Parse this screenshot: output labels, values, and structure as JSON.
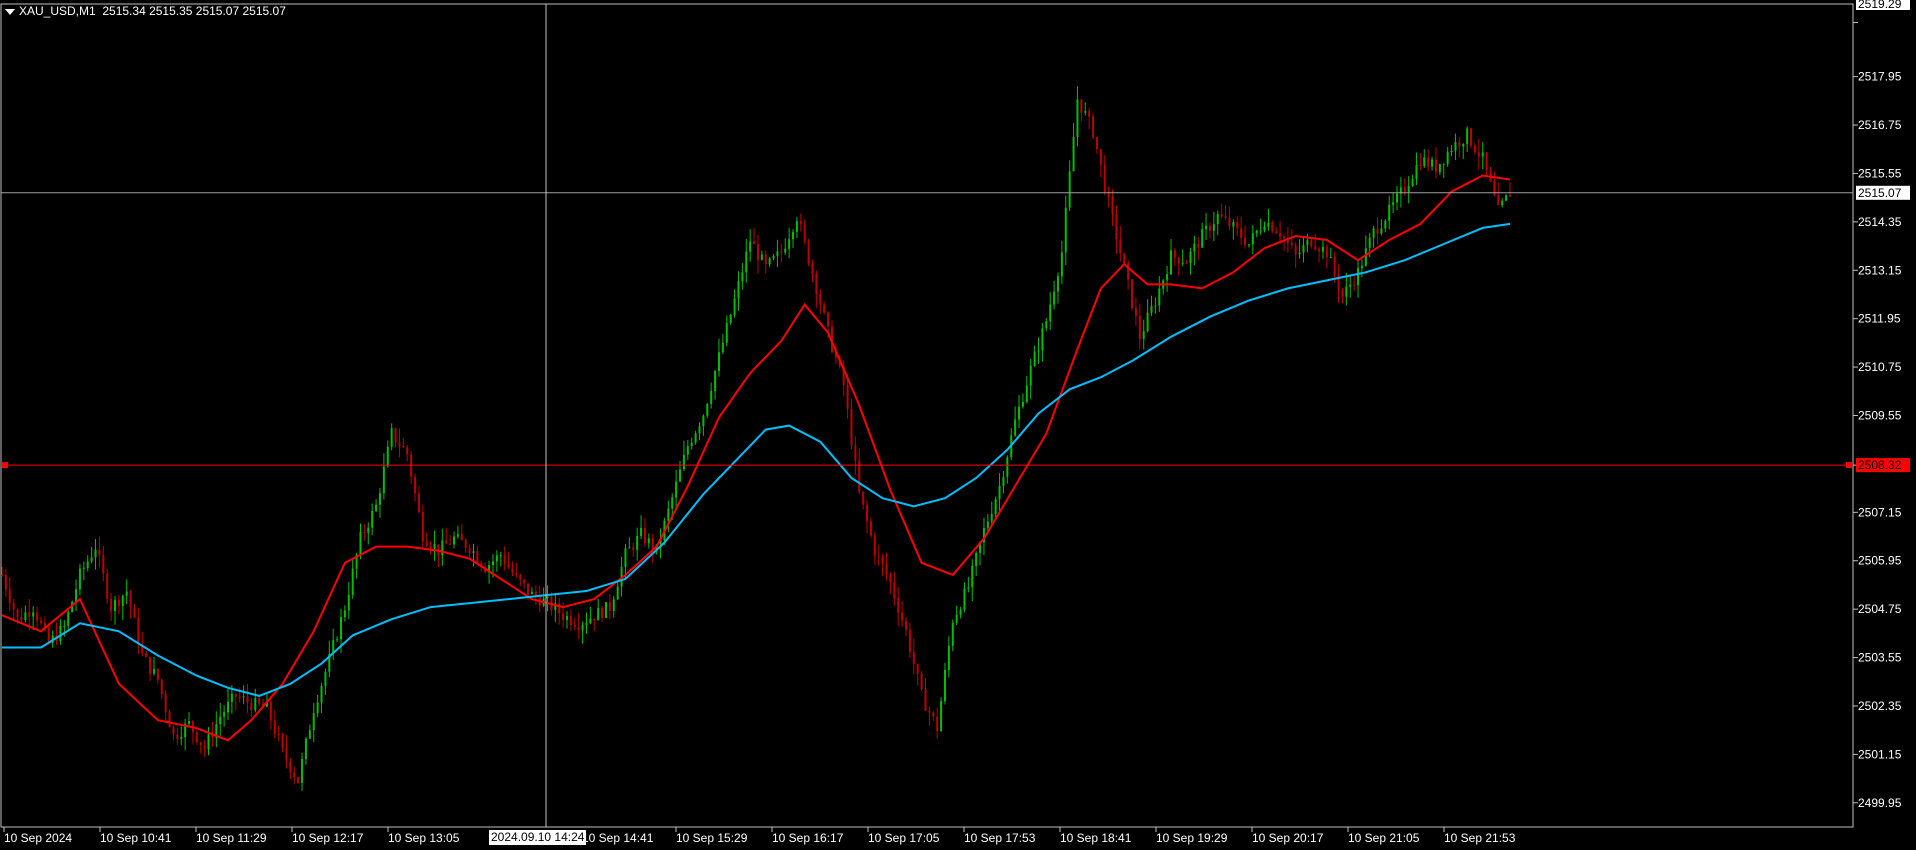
{
  "window": {
    "symbol_title": "XAU_USD,M1",
    "ohlc": "2515.34 2515.35 2515.07 2515.07",
    "crosshair_time": "2024.09.10 14:24"
  },
  "colors": {
    "background": "#000000",
    "grid_frame": "#c0c0c0",
    "bull": "#00c000",
    "bear": "#c00000",
    "ma_fast": "#ff0000",
    "ma_slow": "#00bfff",
    "hline": "#ff0000",
    "bid_line": "#a0a0a0"
  },
  "chart_data": {
    "type": "line",
    "title": "XAU_USD,M1",
    "ylim": [
      2499.35,
      2519.75
    ],
    "y_ticks": [
      "2519.29",
      "2517.95",
      "2516.75",
      "2515.55",
      "2514.35",
      "2513.15",
      "2511.95",
      "2510.75",
      "2509.55",
      "2508.32",
      "2507.15",
      "2505.95",
      "2504.75",
      "2503.55",
      "2502.35",
      "2501.15",
      "2499.95"
    ],
    "x_ticks": [
      "10 Sep 2024",
      "10 Sep 10:41",
      "10 Sep 11:29",
      "10 Sep 12:17",
      "10 Sep 13:05",
      "10 Sep 14:24",
      "10 Sep 15:29",
      "10 Sep 16:17",
      "10 Sep 17:05",
      "10 Sep 17:53",
      "10 Sep 18:41",
      "10 Sep 19:29",
      "10 Sep 20:17",
      "10 Sep 21:05",
      "10 Sep 21:53"
    ],
    "x_tick_partial_label": "10 Sep 14:41",
    "current_price": "2515.07",
    "horizontal_level": "2508.32",
    "top_label": "2519.29",
    "price_path": [
      [
        0,
        2505.6
      ],
      [
        4,
        2504.5
      ],
      [
        8,
        2504.8
      ],
      [
        12,
        2503.9
      ],
      [
        16,
        2504.3
      ],
      [
        20,
        2505.6
      ],
      [
        24,
        2506.3
      ],
      [
        28,
        2504.8
      ],
      [
        32,
        2505.2
      ],
      [
        36,
        2503.6
      ],
      [
        40,
        2503.0
      ],
      [
        44,
        2501.6
      ],
      [
        48,
        2501.9
      ],
      [
        52,
        2501.3
      ],
      [
        56,
        2502.1
      ],
      [
        60,
        2502.6
      ],
      [
        64,
        2502.4
      ],
      [
        68,
        2502.3
      ],
      [
        72,
        2501.2
      ],
      [
        76,
        2500.5
      ],
      [
        80,
        2502.3
      ],
      [
        84,
        2503.5
      ],
      [
        88,
        2504.8
      ],
      [
        92,
        2506.5
      ],
      [
        96,
        2507.3
      ],
      [
        100,
        2509.1
      ],
      [
        104,
        2508.6
      ],
      [
        108,
        2506.6
      ],
      [
        112,
        2506.2
      ],
      [
        116,
        2506.5
      ],
      [
        120,
        2506.3
      ],
      [
        124,
        2505.8
      ],
      [
        128,
        2506.1
      ],
      [
        132,
        2505.5
      ],
      [
        136,
        2505.1
      ],
      [
        140,
        2504.9
      ],
      [
        144,
        2504.6
      ],
      [
        148,
        2504.4
      ],
      [
        152,
        2504.6
      ],
      [
        156,
        2504.8
      ],
      [
        160,
        2506.1
      ],
      [
        164,
        2506.6
      ],
      [
        168,
        2506.2
      ],
      [
        172,
        2507.5
      ],
      [
        176,
        2508.8
      ],
      [
        180,
        2509.6
      ],
      [
        184,
        2511.0
      ],
      [
        188,
        2512.4
      ],
      [
        192,
        2513.9
      ],
      [
        196,
        2513.2
      ],
      [
        200,
        2513.6
      ],
      [
        204,
        2514.5
      ],
      [
        208,
        2513.1
      ],
      [
        212,
        2511.6
      ],
      [
        216,
        2510.3
      ],
      [
        220,
        2507.6
      ],
      [
        224,
        2506.2
      ],
      [
        228,
        2505.4
      ],
      [
        232,
        2504.2
      ],
      [
        236,
        2502.6
      ],
      [
        240,
        2501.8
      ],
      [
        244,
        2504.5
      ],
      [
        248,
        2505.3
      ],
      [
        252,
        2506.7
      ],
      [
        256,
        2507.8
      ],
      [
        260,
        2509.4
      ],
      [
        264,
        2510.7
      ],
      [
        268,
        2511.9
      ],
      [
        272,
        2513.6
      ],
      [
        276,
        2517.4
      ],
      [
        280,
        2516.6
      ],
      [
        284,
        2514.8
      ],
      [
        288,
        2513.2
      ],
      [
        292,
        2511.5
      ],
      [
        296,
        2512.4
      ],
      [
        300,
        2513.5
      ],
      [
        304,
        2513.4
      ],
      [
        308,
        2514.0
      ],
      [
        312,
        2514.5
      ],
      [
        316,
        2514.2
      ],
      [
        320,
        2513.8
      ],
      [
        324,
        2514.4
      ],
      [
        328,
        2514.1
      ],
      [
        332,
        2513.5
      ],
      [
        336,
        2513.9
      ],
      [
        340,
        2513.6
      ],
      [
        344,
        2512.5
      ],
      [
        348,
        2513.1
      ],
      [
        352,
        2514.1
      ],
      [
        356,
        2514.6
      ],
      [
        360,
        2515.2
      ],
      [
        364,
        2515.9
      ],
      [
        368,
        2515.7
      ],
      [
        372,
        2516.2
      ],
      [
        376,
        2516.5
      ],
      [
        380,
        2515.9
      ],
      [
        384,
        2514.6
      ],
      [
        387,
        2515.07
      ]
    ],
    "series": [
      {
        "name": "",
        "color": "#ff0000",
        "points": [
          [
            0,
            2504.6
          ],
          [
            10,
            2504.2
          ],
          [
            20,
            2505.0
          ],
          [
            30,
            2502.9
          ],
          [
            40,
            2502.0
          ],
          [
            50,
            2501.8
          ],
          [
            58,
            2501.5
          ],
          [
            64,
            2502.0
          ],
          [
            72,
            2502.9
          ],
          [
            80,
            2504.2
          ],
          [
            88,
            2505.9
          ],
          [
            96,
            2506.3
          ],
          [
            104,
            2506.3
          ],
          [
            112,
            2506.2
          ],
          [
            120,
            2506.0
          ],
          [
            128,
            2505.5
          ],
          [
            136,
            2505.0
          ],
          [
            144,
            2504.8
          ],
          [
            152,
            2505.0
          ],
          [
            160,
            2505.6
          ],
          [
            168,
            2506.3
          ],
          [
            176,
            2507.8
          ],
          [
            184,
            2509.5
          ],
          [
            192,
            2510.6
          ],
          [
            200,
            2511.4
          ],
          [
            206,
            2512.3
          ],
          [
            212,
            2511.6
          ],
          [
            220,
            2509.8
          ],
          [
            228,
            2507.7
          ],
          [
            236,
            2505.9
          ],
          [
            244,
            2505.6
          ],
          [
            252,
            2506.5
          ],
          [
            260,
            2507.8
          ],
          [
            268,
            2509.1
          ],
          [
            276,
            2511.2
          ],
          [
            282,
            2512.7
          ],
          [
            288,
            2513.3
          ],
          [
            294,
            2512.8
          ],
          [
            300,
            2512.8
          ],
          [
            308,
            2512.7
          ],
          [
            316,
            2513.1
          ],
          [
            324,
            2513.7
          ],
          [
            332,
            2514.0
          ],
          [
            340,
            2513.9
          ],
          [
            348,
            2513.4
          ],
          [
            356,
            2513.9
          ],
          [
            364,
            2514.3
          ],
          [
            372,
            2515.1
          ],
          [
            380,
            2515.5
          ],
          [
            387,
            2515.4
          ]
        ]
      },
      {
        "name": "",
        "color": "#00bfff",
        "points": [
          [
            0,
            2503.8
          ],
          [
            10,
            2503.8
          ],
          [
            20,
            2504.4
          ],
          [
            30,
            2504.2
          ],
          [
            40,
            2503.6
          ],
          [
            50,
            2503.1
          ],
          [
            58,
            2502.8
          ],
          [
            66,
            2502.6
          ],
          [
            74,
            2502.9
          ],
          [
            82,
            2503.4
          ],
          [
            90,
            2504.1
          ],
          [
            100,
            2504.5
          ],
          [
            110,
            2504.8
          ],
          [
            120,
            2504.9
          ],
          [
            130,
            2505.0
          ],
          [
            140,
            2505.1
          ],
          [
            150,
            2505.2
          ],
          [
            160,
            2505.5
          ],
          [
            170,
            2506.4
          ],
          [
            180,
            2507.6
          ],
          [
            190,
            2508.6
          ],
          [
            196,
            2509.2
          ],
          [
            202,
            2509.3
          ],
          [
            210,
            2508.9
          ],
          [
            218,
            2508.0
          ],
          [
            226,
            2507.5
          ],
          [
            234,
            2507.3
          ],
          [
            242,
            2507.5
          ],
          [
            250,
            2508.0
          ],
          [
            258,
            2508.7
          ],
          [
            266,
            2509.6
          ],
          [
            274,
            2510.2
          ],
          [
            282,
            2510.5
          ],
          [
            290,
            2510.9
          ],
          [
            300,
            2511.5
          ],
          [
            310,
            2512.0
          ],
          [
            320,
            2512.4
          ],
          [
            330,
            2512.7
          ],
          [
            340,
            2512.9
          ],
          [
            350,
            2513.1
          ],
          [
            360,
            2513.4
          ],
          [
            370,
            2513.8
          ],
          [
            380,
            2514.2
          ],
          [
            387,
            2514.3
          ]
        ]
      }
    ]
  }
}
